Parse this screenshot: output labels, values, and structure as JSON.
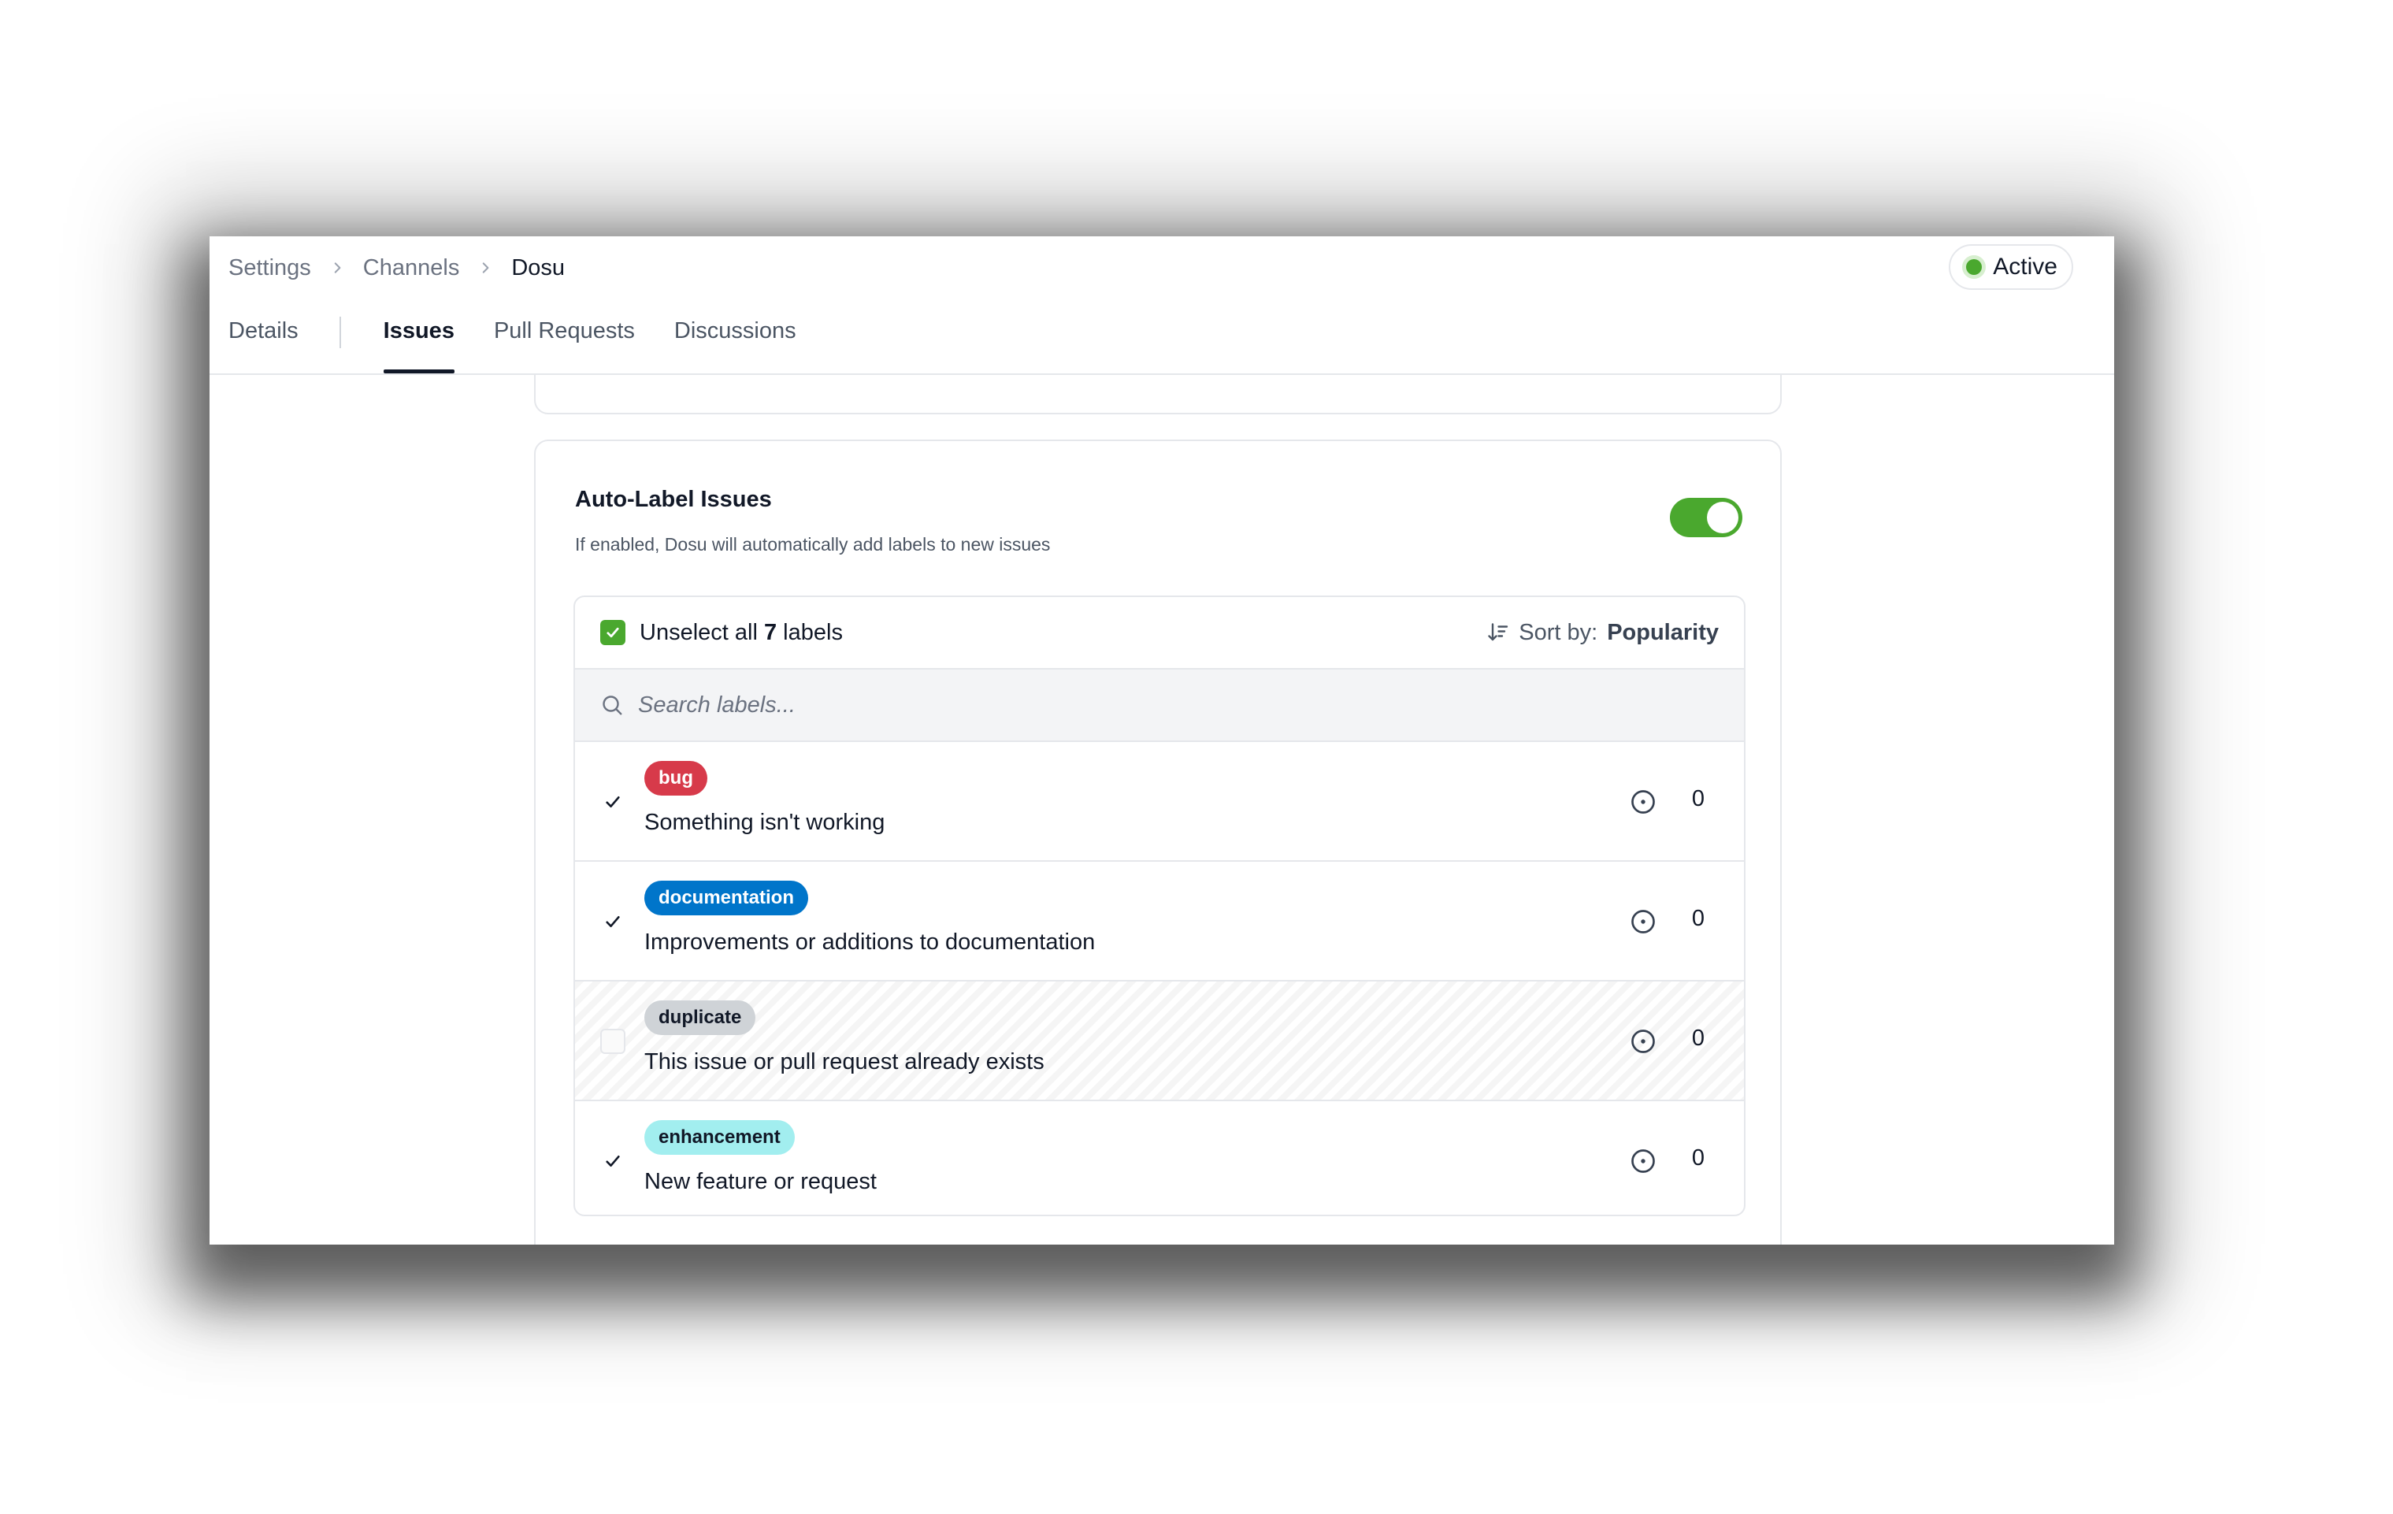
{
  "breadcrumb": [
    "Settings",
    "Channels",
    "Dosu"
  ],
  "status": {
    "label": "Active",
    "color": "#4aa82e"
  },
  "tabs": [
    {
      "label": "Details",
      "active": false
    },
    {
      "label": "Issues",
      "active": true
    },
    {
      "label": "Pull Requests",
      "active": false
    },
    {
      "label": "Discussions",
      "active": false
    }
  ],
  "auto_label": {
    "title": "Auto-Label Issues",
    "description": "If enabled, Dosu will automatically add labels to new issues",
    "enabled": true,
    "toggle_color": "#4aa82e"
  },
  "labels_panel": {
    "select_all_prefix": "Unselect all",
    "select_all_count": "7",
    "select_all_suffix": "labels",
    "sort_label": "Sort by:",
    "sort_value": "Popularity",
    "search_placeholder": "Search labels..."
  },
  "labels": [
    {
      "name": "bug",
      "description": "Something isn't working",
      "count": "0",
      "checked": true,
      "bg": "#d73a4a",
      "fg": "#ffffff"
    },
    {
      "name": "documentation",
      "description": "Improvements or additions to documentation",
      "count": "0",
      "checked": true,
      "bg": "#0075ca",
      "fg": "#ffffff"
    },
    {
      "name": "duplicate",
      "description": "This issue or pull request already exists",
      "count": "0",
      "checked": false,
      "bg": "#cfd3d7",
      "fg": "#111827"
    },
    {
      "name": "enhancement",
      "description": "New feature or request",
      "count": "0",
      "checked": true,
      "bg": "#a2eeef",
      "fg": "#111827"
    }
  ]
}
